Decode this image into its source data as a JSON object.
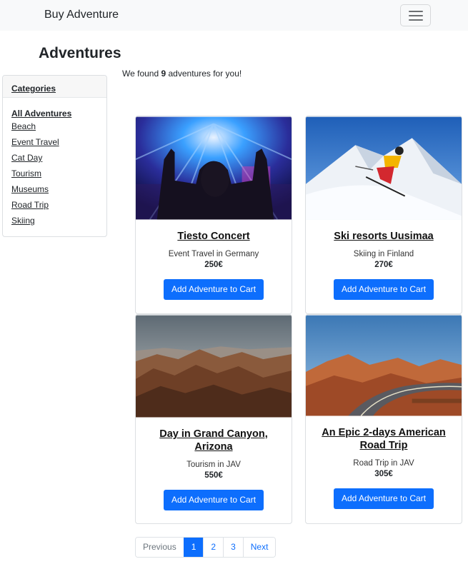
{
  "navbar": {
    "brand": "Buy Adventure",
    "toggler_icon": "hamburger-icon"
  },
  "page": {
    "title": "Adventures",
    "found_prefix": "We found ",
    "found_count": "9",
    "found_suffix": " adventures for you!"
  },
  "sidebar": {
    "header": "Categories",
    "items": [
      {
        "label": "All Adventures"
      },
      {
        "label": "Beach"
      },
      {
        "label": "Event Travel"
      },
      {
        "label": "Cat Day"
      },
      {
        "label": "Tourism"
      },
      {
        "label": "Museums"
      },
      {
        "label": "Road Trip"
      },
      {
        "label": "Skiing"
      }
    ]
  },
  "cards": [
    {
      "title": "Tiesto Concert",
      "subtitle": "Event Travel in Germany",
      "price": "250€",
      "button": "Add Adventure to Cart",
      "image": "concert-photo"
    },
    {
      "title": "Ski resorts Uusimaa",
      "subtitle": "Skiing in Finland",
      "price": "270€",
      "button": "Add Adventure to Cart",
      "image": "skier-photo"
    },
    {
      "title": "Day in Grand Canyon, Arizona",
      "subtitle": "Tourism in JAV",
      "price": "550€",
      "button": "Add Adventure to Cart",
      "image": "canyon-photo"
    },
    {
      "title": "An Epic 2-days American Road Trip",
      "subtitle": "Road Trip in JAV",
      "price": "305€",
      "button": "Add Adventure to Cart",
      "image": "desert-road-photo"
    }
  ],
  "pagination": {
    "previous": "Previous",
    "pages": [
      "1",
      "2",
      "3"
    ],
    "current": "1",
    "next": "Next"
  },
  "colors": {
    "primary": "#0d6efd",
    "navbar_bg": "#f8f9fa",
    "text": "#212529"
  }
}
